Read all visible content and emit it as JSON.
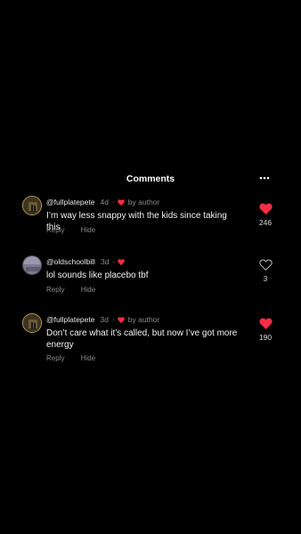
{
  "header": {
    "title": "Comments",
    "more_icon": "more-horizontal-icon"
  },
  "colors": {
    "background": "#000000",
    "heart": "#ff2d45",
    "muted": "#8a8a8a"
  },
  "comments": [
    {
      "username": "@fullplatepete",
      "age": "4d",
      "separator": "·",
      "author_badge": "by author",
      "text": "I’m way less snappy with the kids since taking this",
      "reply_label": "Reply",
      "hide_label": "Hide",
      "likes": "246",
      "liked": true
    },
    {
      "username": "@oldschoolbill",
      "age": "3d",
      "separator": "·",
      "text": "lol sounds like placebo tbf",
      "reply_label": "Reply",
      "hide_label": "Hide",
      "likes": "3",
      "liked": false
    },
    {
      "username": "@fullplatepete",
      "age": "3d",
      "separator": "·",
      "author_badge": "by author",
      "text": "Don’t care what it’s called, but now I’ve got more energy",
      "reply_label": "Reply",
      "hide_label": "Hide",
      "likes": "190",
      "liked": true
    }
  ]
}
